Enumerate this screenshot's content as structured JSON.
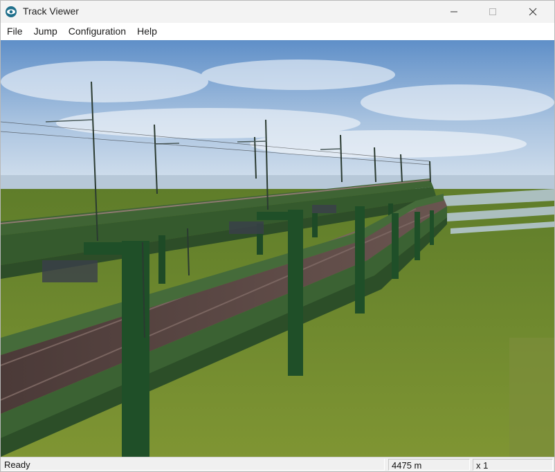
{
  "window": {
    "title": "Track Viewer",
    "app_icon": "eye-icon",
    "controls": [
      "minimize-icon",
      "maximize-icon",
      "close-icon"
    ]
  },
  "menu": {
    "items": [
      {
        "label": "File"
      },
      {
        "label": "Jump"
      },
      {
        "label": "Configuration"
      },
      {
        "label": "Help"
      }
    ]
  },
  "viewport": {
    "scene": "elevated railway viaduct with overhead catenary masts over grassland",
    "colors": {
      "sky_top": "#5f8fc8",
      "sky_bottom": "#c9d9ea",
      "grass": "#6f8a2c",
      "structure": "#2f5a2a",
      "deck": "#5a4440"
    }
  },
  "status": {
    "state": "Ready",
    "distance": "4475 m",
    "speed": "x 1"
  }
}
